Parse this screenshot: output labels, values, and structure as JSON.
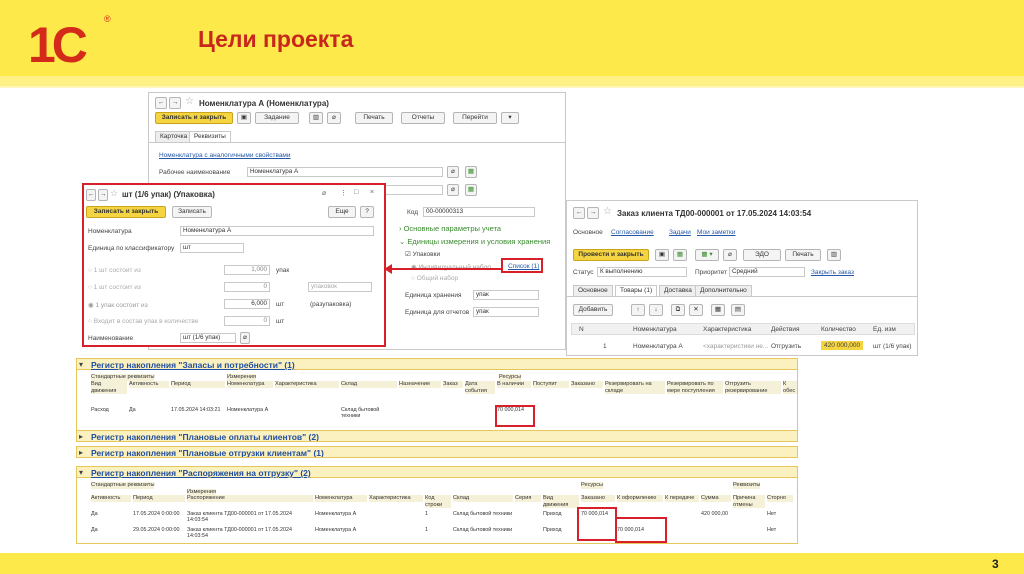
{
  "slide": {
    "title": "Цели проекта",
    "page": "3",
    "logo": "1С",
    "logo_mark": "®"
  },
  "colors": {
    "accent_red": "#d42a1a",
    "band_yellow": "#fde94a",
    "highlight_red": "#d8202a",
    "save_yellow": "#f5d442"
  },
  "nomen": {
    "title": "Номенклатура А (Номенклатура)",
    "btn_save_close": "Записать и закрыть",
    "btn_task": "Задание",
    "btn_print": "Печать",
    "btn_reports": "Отчеты",
    "btn_goto": "Перейти",
    "tab_card": "Карточка",
    "tab_requisites": "Реквизиты",
    "similar_link": "Номенклатура с аналогичными свойствами",
    "work_name_label": "Рабочее наименование",
    "work_name_value": "Номенклатура А",
    "code_label": "Код",
    "code_value": "00-00000313",
    "basic_params": "Основные параметры учета",
    "units_section": "Единицы измерения и условия хранения",
    "packages": "Упаковки",
    "individual_set": "Индивидуальный набор",
    "list_link": "Список (1)",
    "common_set": "Общий набор",
    "storage_unit_label": "Единица хранения",
    "storage_unit_value": "упак",
    "reports_unit_label": "Единица для отчетов",
    "reports_unit_value": "упак"
  },
  "package": {
    "title": "шт (1/6 упак) (Упаковка)",
    "btn_save_close": "Записать и закрыть",
    "btn_save": "Записать",
    "btn_more": "Еще",
    "btn_help": "?",
    "nomen_label": "Номенклатура",
    "nomen_value": "Номенклатура А",
    "unit_label": "Единица по классификатору",
    "unit_value": "шт",
    "r1_label": "1 шт состоит из",
    "r1_value": "1,000",
    "r1_unit": "упак",
    "r2_label": "1 шт состоит из",
    "r2_value": "0",
    "r2_unit": "упаковок",
    "r3_label": "1 упак состоит из",
    "r3_value": "6,000",
    "r3_unit": "шт",
    "r3_note": "(разупаковка)",
    "r4_label": "Входит в состав упак в количестве",
    "r4_value": "0",
    "r4_unit": "шт",
    "name_label": "Наименование",
    "name_value": "шт (1/6 упак)"
  },
  "order": {
    "title": "Заказ клиента ТД00-000001 от 17.05.2024 14:03:54",
    "nav_main": "Основное",
    "nav_approval": "Согласование",
    "nav_tasks": "Задачи",
    "nav_notes": "Мои заметки",
    "btn_post_close": "Провести и закрыть",
    "btn_edo": "ЭДО",
    "btn_print": "Печать",
    "status_label": "Статус",
    "status_value": "К выполнению",
    "priority_label": "Приоритет",
    "priority_value": "Средний",
    "close_order": "Закрыть заказ",
    "tabs": [
      "Основное",
      "Товары (1)",
      "Доставка",
      "Дополнительно"
    ],
    "btn_add": "Добавить",
    "columns": [
      "N",
      "Номенклатура",
      "Характеристика",
      "Действия",
      "Количество",
      "Ед. изм"
    ],
    "row": {
      "n": "1",
      "nomen": "Номенклатура А",
      "char": "<характеристики не...",
      "action": "Отгрузить",
      "qty": "420 000,000",
      "unit": "шт (1/6 упак)"
    }
  },
  "reg1": {
    "title": "Регистр накопления \"Запасы и потребности\" (1)",
    "g_std": "Стандартные реквизиты",
    "g_dims": "Измерения",
    "g_res": "Ресурсы",
    "headers": [
      "Вид движения",
      "Активность",
      "Период",
      "Номенклатура",
      "Характеристика",
      "Склад",
      "Назначение",
      "Заказ",
      "Дата события",
      "В наличии",
      "Поступит",
      "Заказано",
      "Резервировать на складе",
      "Резервировать по мере поступления",
      "Отгрузить резервирование",
      "К обес"
    ],
    "row": [
      "Расход",
      "Да",
      "17.05.2024 14:03:21",
      "Номенклатура А",
      "",
      "Склад бытовой техники",
      "",
      "",
      "",
      "70 000,014",
      "",
      "",
      "",
      "",
      "",
      ""
    ]
  },
  "reg2": {
    "title": "Регистр накопления \"Плановые оплаты клиентов\" (2)"
  },
  "reg3": {
    "title": "Регистр накопления \"Плановые отгрузки клиентам\" (1)"
  },
  "reg4": {
    "title": "Регистр накопления \"Распоряжения на отгрузку\" (2)",
    "g_std": "Стандартные реквизиты",
    "g_dims": "Измерения",
    "g_res": "Ресурсы",
    "g_req": "Реквизиты",
    "headers": [
      "Активность",
      "Период",
      "Распоряжение",
      "Номенклатура",
      "Характеристика",
      "Код строки",
      "Склад",
      "Серия",
      "Вид движения",
      "Заказано",
      "К оформлению",
      "К передаче",
      "Сумма",
      "Причина отмены",
      "Сторно"
    ],
    "rows": [
      [
        "Да",
        "17.05.2024 0:00:00",
        "Заказ клиента ТД00-000001 от 17.05.2024 14:03:54",
        "Номенклатура А",
        "",
        "1",
        "Склад бытовой техники",
        "",
        "Приход",
        "70 000,014",
        "",
        "",
        "420 000,00",
        "",
        "Нет"
      ],
      [
        "Да",
        "29.05.2024 0:00:00",
        "Заказ клиента ТД00-000001 от 17.05.2024 14:03:54",
        "Номенклатура А",
        "",
        "1",
        "Склад бытовой техники",
        "",
        "Приход",
        "",
        "70 000,014",
        "",
        "",
        "",
        "Нет"
      ]
    ]
  }
}
